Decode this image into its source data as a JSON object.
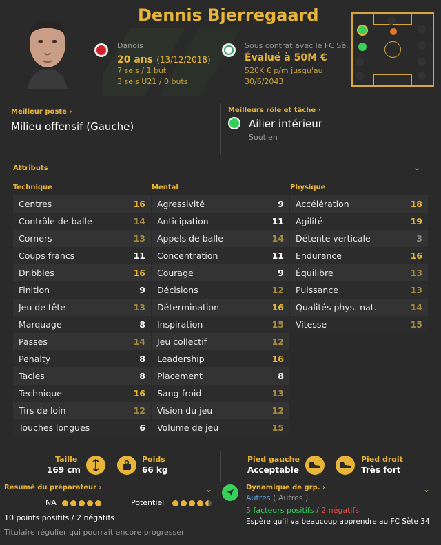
{
  "player": {
    "name": "Dennis Bjerregaard",
    "nationality": "Danois",
    "age": "20 ans",
    "dob": "(13/12/2018)",
    "caps": "7 sels / 1 but",
    "u21": "3 sels U21 / 0 buts",
    "contract_with": "Sous contrat avec le FC Sè...",
    "value": "Évalué à 50M €",
    "wage": "520K € p/m jusqu'au",
    "contract_end": "30/6/2043"
  },
  "best_position": {
    "label": "Meilleur poste",
    "value": "Milieu offensif (Gauche)"
  },
  "best_role": {
    "label": "Meilleurs rôle et tâche",
    "role": "Ailier intérieur",
    "duty": "Soutien"
  },
  "attributes": {
    "title": "Attributs",
    "technical": {
      "title": "Technique",
      "items": [
        {
          "name": "Centres",
          "value": "16"
        },
        {
          "name": "Contrôle de balle",
          "value": "14"
        },
        {
          "name": "Corners",
          "value": "13"
        },
        {
          "name": "Coups francs",
          "value": "11"
        },
        {
          "name": "Dribbles",
          "value": "16"
        },
        {
          "name": "Finition",
          "value": "9"
        },
        {
          "name": "Jeu de tête",
          "value": "13"
        },
        {
          "name": "Marquage",
          "value": "8"
        },
        {
          "name": "Passes",
          "value": "14"
        },
        {
          "name": "Penalty",
          "value": "8"
        },
        {
          "name": "Tacles",
          "value": "8"
        },
        {
          "name": "Technique",
          "value": "16"
        },
        {
          "name": "Tirs de loin",
          "value": "12"
        },
        {
          "name": "Touches longues",
          "value": "6"
        }
      ]
    },
    "mental": {
      "title": "Mental",
      "items": [
        {
          "name": "Agressivité",
          "value": "9"
        },
        {
          "name": "Anticipation",
          "value": "11"
        },
        {
          "name": "Appels de balle",
          "value": "14"
        },
        {
          "name": "Concentration",
          "value": "11"
        },
        {
          "name": "Courage",
          "value": "9"
        },
        {
          "name": "Décisions",
          "value": "12"
        },
        {
          "name": "Détermination",
          "value": "16"
        },
        {
          "name": "Inspiration",
          "value": "15"
        },
        {
          "name": "Jeu collectif",
          "value": "12"
        },
        {
          "name": "Leadership",
          "value": "16"
        },
        {
          "name": "Placement",
          "value": "8"
        },
        {
          "name": "Sang-froid",
          "value": "13"
        },
        {
          "name": "Vision du jeu",
          "value": "12"
        },
        {
          "name": "Volume de jeu",
          "value": "15"
        }
      ]
    },
    "physical": {
      "title": "Physique",
      "items": [
        {
          "name": "Accélération",
          "value": "18"
        },
        {
          "name": "Agilité",
          "value": "19"
        },
        {
          "name": "Détente verticale",
          "value": "3"
        },
        {
          "name": "Endurance",
          "value": "16"
        },
        {
          "name": "Équilibre",
          "value": "13"
        },
        {
          "name": "Puissance",
          "value": "13"
        },
        {
          "name": "Qualités phys. nat.",
          "value": "14"
        },
        {
          "name": "Vitesse",
          "value": "15"
        }
      ]
    }
  },
  "body": {
    "height_label": "Taille",
    "height": "169 cm",
    "weight_label": "Poids",
    "weight": "66 kg",
    "left_foot_label": "Pied gauche",
    "left_foot": "Acceptable",
    "right_foot_label": "Pied droit",
    "right_foot": "Très fort"
  },
  "coach": {
    "title": "Résumé du préparateur",
    "ability_label": "NA",
    "potential_label": "Potentiel",
    "ability_stars": 5,
    "potential_stars": 4.5,
    "points": "10 points positifs / 2 négatifs",
    "summary": "Titulaire régulier qui pourrait encore progresser"
  },
  "group": {
    "title": "Dynamique de grp.",
    "group": "Autres",
    "group_paren": "( Autres )",
    "positive": "5 facteurs positifs",
    "sep": "/",
    "negative": "2 négatifs",
    "note": "Espère qu'il va beaucoup apprendre au FC Sète 34"
  },
  "colors": {
    "accent": "#e8b53a",
    "positive": "#36d15a",
    "negative": "#e8504a",
    "link": "#5aa0e6"
  }
}
